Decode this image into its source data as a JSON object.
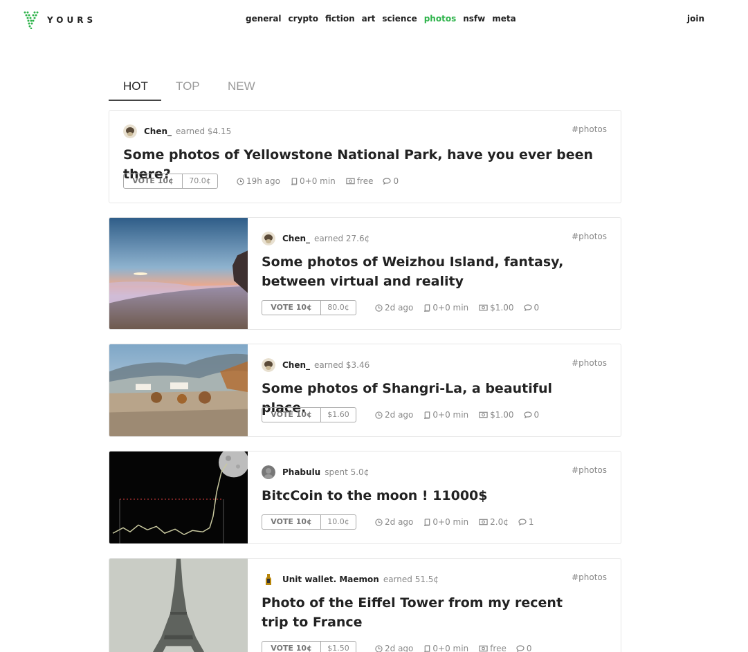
{
  "brand": {
    "name": "YOURS",
    "accent": "#2db34a"
  },
  "nav": {
    "items": [
      {
        "label": "general",
        "active": false
      },
      {
        "label": "crypto",
        "active": false
      },
      {
        "label": "fiction",
        "active": false
      },
      {
        "label": "art",
        "active": false
      },
      {
        "label": "science",
        "active": false
      },
      {
        "label": "photos",
        "active": true
      },
      {
        "label": "nsfw",
        "active": false
      },
      {
        "label": "meta",
        "active": false
      }
    ],
    "join_label": "join"
  },
  "tabs": [
    {
      "label": "HOT",
      "active": true
    },
    {
      "label": "TOP",
      "active": false
    },
    {
      "label": "NEW",
      "active": false
    }
  ],
  "posts": [
    {
      "author": "Chen_",
      "earned": "earned $4.15",
      "tag": "#photos",
      "title": "Some photos of Yellowstone National Park, have you ever been there?",
      "vote_label": "VOTE 10¢",
      "vote_price": "70.0¢",
      "time": "19h ago",
      "read": "0+0 min",
      "price": "free",
      "comments": "0",
      "thumbnail": "none"
    },
    {
      "author": "Chen_",
      "earned": "earned 27.6¢",
      "tag": "#photos",
      "title": "Some photos of Weizhou Island, fantasy, between virtual and reality",
      "vote_label": "VOTE 10¢",
      "vote_price": "80.0¢",
      "time": "2d ago",
      "read": "0+0 min",
      "price": "$1.00",
      "comments": "0",
      "thumbnail": "beach-sunset"
    },
    {
      "author": "Chen_",
      "earned": "earned $3.46",
      "tag": "#photos",
      "title": "Some photos of Shangri-La, a beautiful place.",
      "vote_label": "VOTE 10¢",
      "vote_price": "$1.60",
      "time": "2d ago",
      "read": "0+0 min",
      "price": "$1.00",
      "comments": "0",
      "thumbnail": "misty-village"
    },
    {
      "author": "Phabulu",
      "earned": "spent 5.0¢",
      "tag": "#photos",
      "title": "BitcCoin to the moon ! 11000$",
      "vote_label": "VOTE 10¢",
      "vote_price": "10.0¢",
      "time": "2d ago",
      "read": "0+0 min",
      "price": "2.0¢",
      "comments": "1",
      "thumbnail": "moon-chart"
    },
    {
      "author": "Unit wallet. Maemon",
      "earned": "earned 51.5¢",
      "tag": "#photos",
      "title": "Photo of the Eiffel Tower from my recent trip to France",
      "vote_label": "VOTE 10¢",
      "vote_price": "$1.50",
      "time": "2d ago",
      "read": "0+0 min",
      "price": "free",
      "comments": "0",
      "thumbnail": "eiffel-tower"
    }
  ]
}
